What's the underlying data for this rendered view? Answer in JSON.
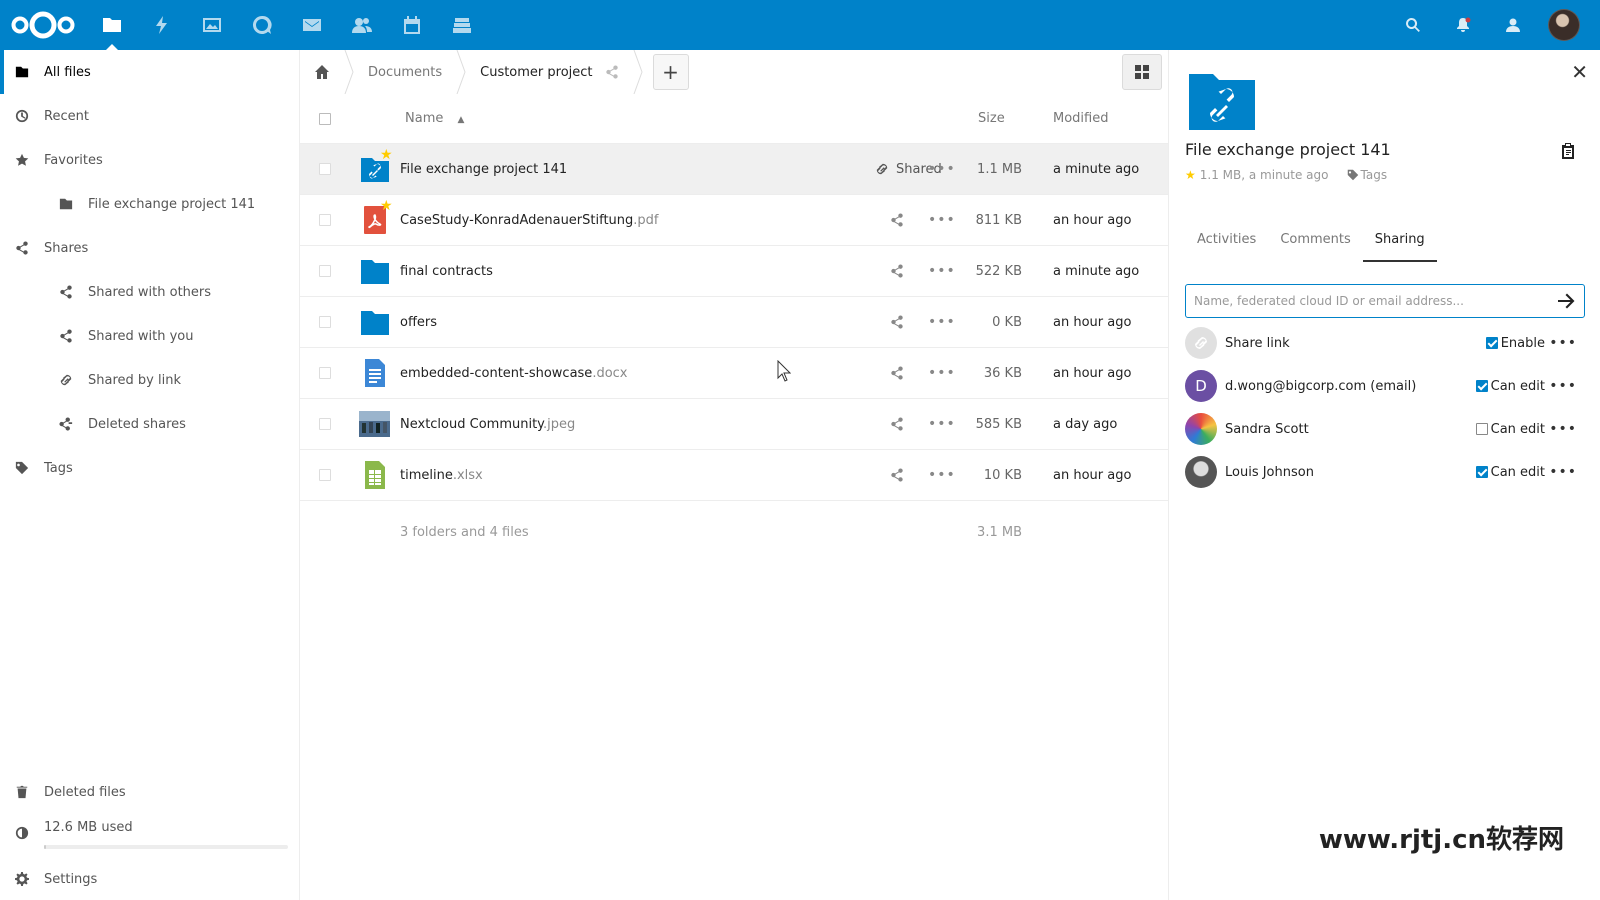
{
  "colors": {
    "brand": "#0082c9",
    "star": "#ffcc00",
    "pdf": "#e2513d",
    "sheet": "#8bb84b",
    "avatar_d": "#6b4fa3"
  },
  "header": {
    "apps": [
      "files-icon",
      "activity-icon",
      "gallery-icon",
      "talk-icon",
      "mail-icon",
      "contacts-icon",
      "calendar-icon",
      "deck-icon"
    ],
    "right": [
      "search-icon",
      "notifications-icon",
      "contacts-menu-icon"
    ]
  },
  "sidebar": {
    "items": [
      {
        "label": "All files"
      },
      {
        "label": "Recent"
      },
      {
        "label": "Favorites"
      },
      {
        "label": "File exchange project 141"
      },
      {
        "label": "Shares"
      },
      {
        "label": "Shared with others"
      },
      {
        "label": "Shared with you"
      },
      {
        "label": "Shared by link"
      },
      {
        "label": "Deleted shares"
      },
      {
        "label": "Tags"
      }
    ],
    "deleted": "Deleted files",
    "quota": "12.6 MB used",
    "quota_fraction": 0.01,
    "settings": "Settings"
  },
  "breadcrumb": {
    "c1": "Documents",
    "c2": "Customer project",
    "add": "+"
  },
  "filelist": {
    "headers": {
      "name": "Name",
      "size": "Size",
      "modified": "Modified"
    },
    "files": [
      {
        "name": "File exchange project 141",
        "ext": "",
        "size": "1.1 MB",
        "modified": "a minute ago",
        "shared": "Shared"
      },
      {
        "name": "CaseStudy-KonradAdenauerStiftung",
        "ext": ".pdf",
        "size": "811 KB",
        "modified": "an hour ago"
      },
      {
        "name": "final contracts",
        "ext": "",
        "size": "522 KB",
        "modified": "a minute ago"
      },
      {
        "name": "offers",
        "ext": "",
        "size": "0 KB",
        "modified": "an hour ago"
      },
      {
        "name": "embedded-content-showcase",
        "ext": ".docx",
        "size": "36 KB",
        "modified": "an hour ago"
      },
      {
        "name": "Nextcloud Community",
        "ext": ".jpeg",
        "size": "585 KB",
        "modified": "a day ago"
      },
      {
        "name": "timeline",
        "ext": ".xlsx",
        "size": "10 KB",
        "modified": "an hour ago"
      }
    ],
    "summary": "3 folders and 4 files",
    "summary_size": "3.1 MB",
    "more": "•••"
  },
  "details": {
    "title": "File exchange project 141",
    "meta": "1.1 MB, a minute ago",
    "tags": "Tags",
    "tabs": [
      "Activities",
      "Comments",
      "Sharing"
    ],
    "placeholder": "Name, federated cloud ID or email address...",
    "shares": [
      {
        "name": "Share link",
        "perm": "Enable",
        "checked": true
      },
      {
        "name": "d.wong@bigcorp.com (email)",
        "initial": "D",
        "perm": "Can edit",
        "checked": true
      },
      {
        "name": "Sandra Scott",
        "perm": "Can edit",
        "checked": false
      },
      {
        "name": "Louis Johnson",
        "perm": "Can edit",
        "checked": true
      }
    ],
    "close": "✕"
  },
  "watermark": "www.rjtj.cn软荐网"
}
